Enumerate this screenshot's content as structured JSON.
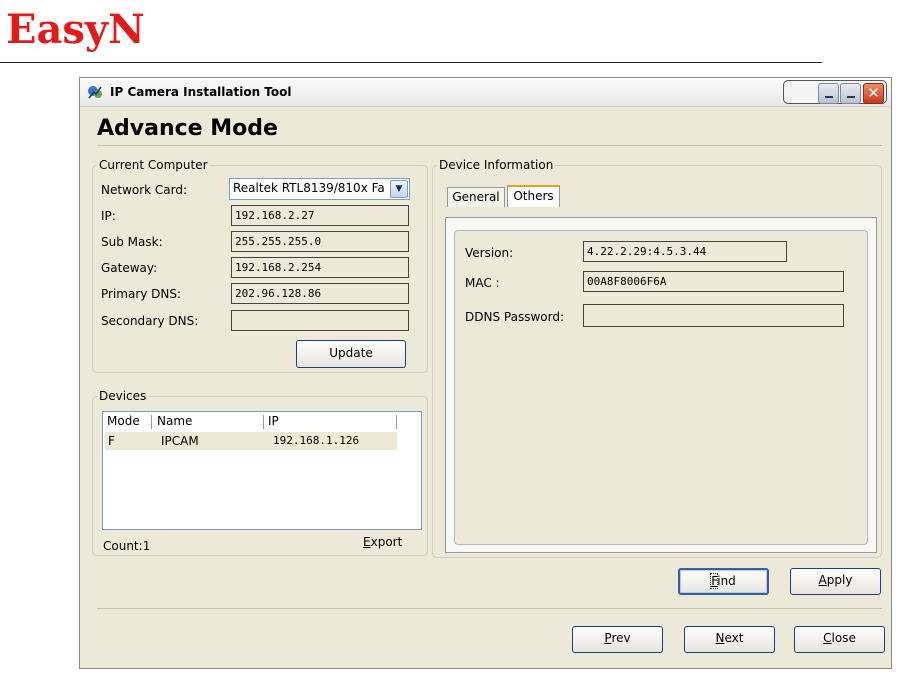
{
  "brand": {
    "logo_text": "EasyN",
    "logo_color": "#e01b1b"
  },
  "window": {
    "title": "IP Camera Installation Tool",
    "controls": {
      "minimize": "minimize",
      "maximize": "restore",
      "close": "✕"
    }
  },
  "page": {
    "heading": "Advance Mode"
  },
  "current_computer": {
    "legend": "Current Computer",
    "network_card_label": "Network Card:",
    "network_card_value": "Realtek RTL8139/810x Fa",
    "ip_label": "IP:",
    "ip_value": "192.168.2.27",
    "submask_label": "Sub Mask:",
    "submask_value": "255.255.255.0",
    "gateway_label": "Gateway:",
    "gateway_value": "192.168.2.254",
    "primary_dns_label": "Primary DNS:",
    "primary_dns_value": "202.96.128.86",
    "secondary_dns_label": "Secondary DNS:",
    "secondary_dns_value": "",
    "update_button": "Update"
  },
  "devices": {
    "legend": "Devices",
    "columns": [
      "Mode",
      "Name",
      "IP"
    ],
    "rows": [
      {
        "mode": "F",
        "name": "IPCAM",
        "ip": "192.168.1.126"
      }
    ],
    "count_label": "Count:",
    "count_value": "1",
    "export_link": "Export"
  },
  "device_info": {
    "legend": "Device Information",
    "tabs": [
      "General",
      "Others"
    ],
    "active_tab": "Others",
    "version_label": "Version:",
    "version_value": "4.22.2.29:4.5.3.44",
    "mac_label": "MAC  :",
    "mac_value": "00A8F8006F6A",
    "ddns_label": "DDNS Password:",
    "ddns_value": ""
  },
  "actions": {
    "find": {
      "label": "Find",
      "accel": "F",
      "rest": "ind"
    },
    "apply": {
      "label": "Apply",
      "accel": "A",
      "rest": "pply"
    },
    "prev": {
      "label": "Prev",
      "accel": "P",
      "rest": "rev"
    },
    "next": {
      "label": "Next",
      "accel": "N",
      "rest": "ext"
    },
    "close": {
      "label": "Close",
      "accel": "C",
      "rest": "lose"
    }
  }
}
